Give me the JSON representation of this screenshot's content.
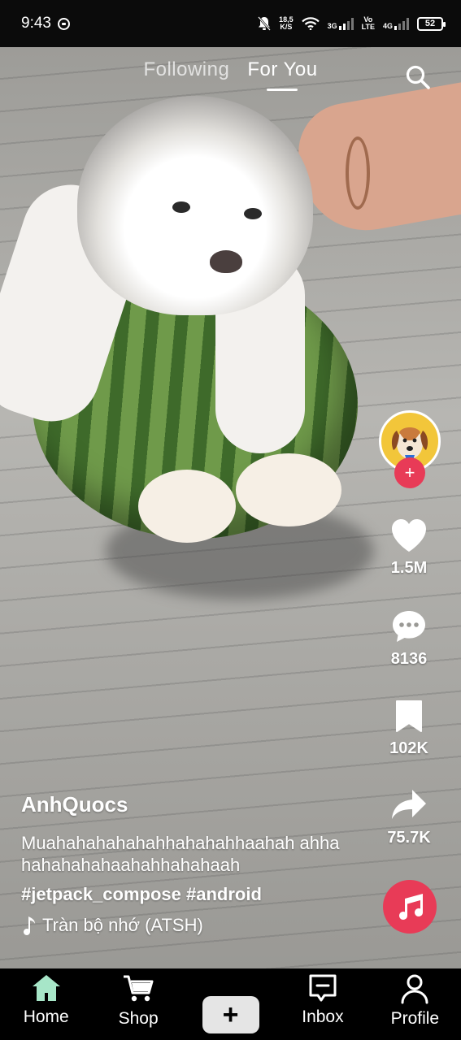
{
  "status_bar": {
    "time": "9:43",
    "net_speed_top": "18,5",
    "net_speed_bottom": "K/S",
    "sim1_label": "3G",
    "volte_top": "Vo",
    "volte_bottom": "LTE",
    "sim2_label": "4G",
    "battery": "52"
  },
  "top_tabs": [
    {
      "label": "Following",
      "active": false
    },
    {
      "label": "For You",
      "active": true
    }
  ],
  "actions": {
    "likes": "1.5M",
    "comments": "8136",
    "bookmarks": "102K",
    "shares": "75.7K"
  },
  "post": {
    "username": "AnhQuocs",
    "description": "Muahahahahahahhahahahhaahah ahhahahahahahaahahhahahaah",
    "hashtags": "#jetpack_compose #android",
    "song": "Tràn bộ nhớ (ATSH)"
  },
  "bottom_nav": [
    {
      "label": "Home",
      "icon": "home-icon",
      "active": true
    },
    {
      "label": "Shop",
      "icon": "cart-icon",
      "active": false
    },
    {
      "label": "",
      "icon": "plus-icon",
      "active": false
    },
    {
      "label": "Inbox",
      "icon": "inbox-icon",
      "active": false
    },
    {
      "label": "Profile",
      "icon": "profile-icon",
      "active": false
    }
  ],
  "colors": {
    "accent": "#e83b57",
    "home_active": "#a7e6c8"
  }
}
